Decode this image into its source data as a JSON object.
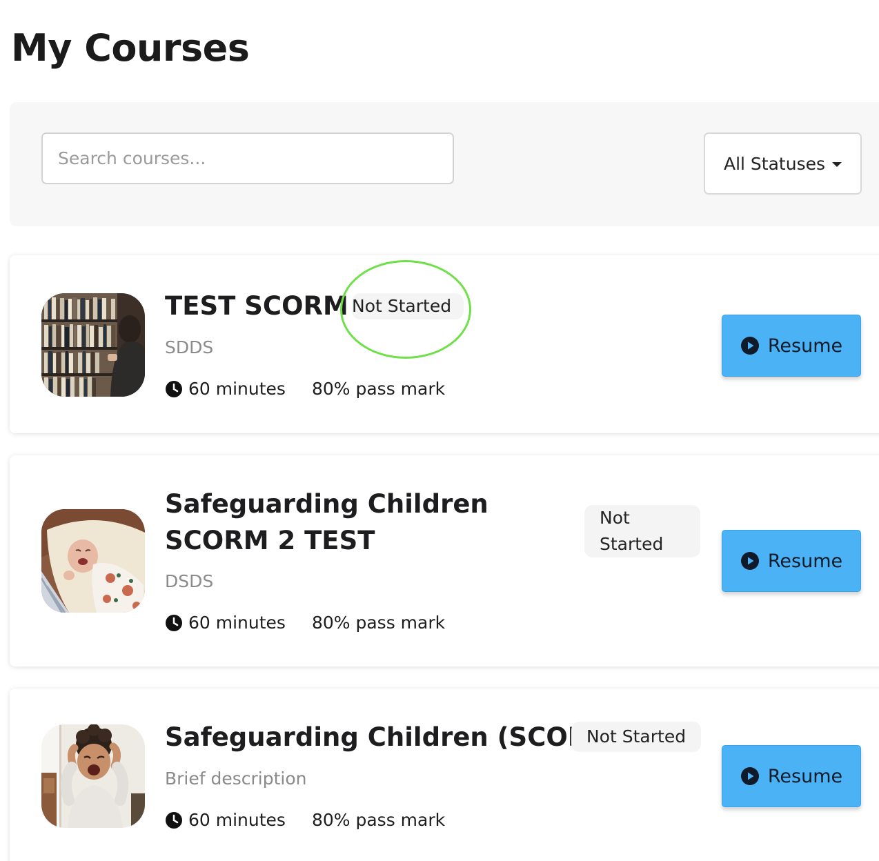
{
  "page": {
    "title": "My Courses"
  },
  "filters": {
    "search_placeholder": "Search courses...",
    "status_label": "All Statuses"
  },
  "courses": [
    {
      "title": "TEST SCORM",
      "status": "Not Started",
      "description": "SDDS",
      "duration": "60 minutes",
      "pass_mark": "80% pass mark",
      "action": "Resume",
      "thumbnail": "library-bookshelf-photo"
    },
    {
      "title": "Safeguarding Children SCORM 2 TEST",
      "status": "Not Started",
      "description": "DSDS",
      "duration": "60 minutes",
      "pass_mark": "80% pass mark",
      "action": "Resume",
      "thumbnail": "crying-baby-photo"
    },
    {
      "title": "Safeguarding Children (SCORM)",
      "status": "Not Started",
      "description": "Brief description",
      "duration": "60 minutes",
      "pass_mark": "80% pass mark",
      "action": "Resume",
      "thumbnail": "screaming-child-photo"
    }
  ],
  "colors": {
    "accent": "#4bb3f5",
    "highlight": "#6fe04a",
    "panel": "#f7f7f7"
  }
}
